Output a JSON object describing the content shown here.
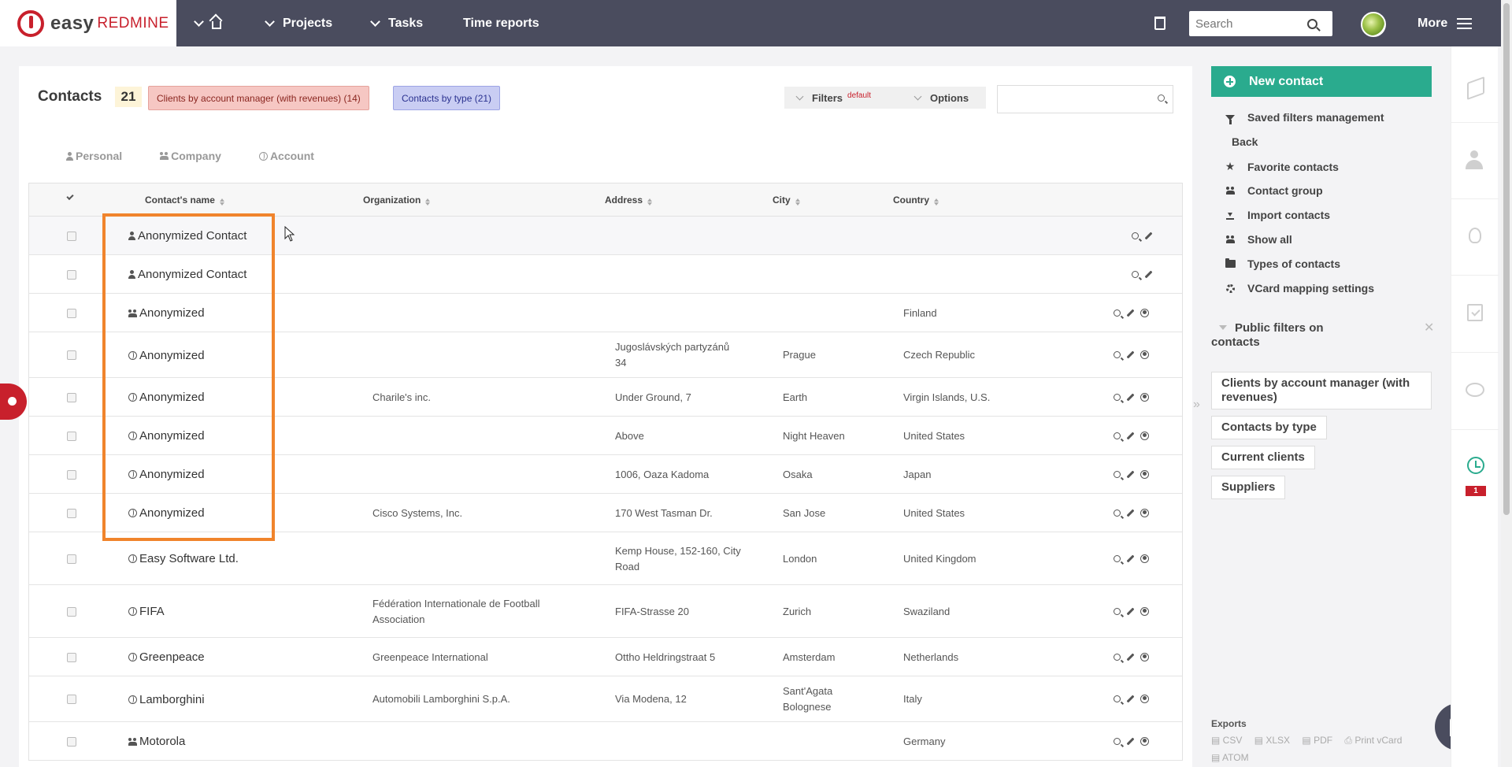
{
  "topbar": {
    "logo": {
      "part1": "easy",
      "part2": "REDMINE"
    },
    "nav": [
      {
        "label": ""
      },
      {
        "label": "Projects"
      },
      {
        "label": "Tasks"
      },
      {
        "label": "Time reports"
      }
    ],
    "search_placeholder": "Search",
    "more_label": "More"
  },
  "main": {
    "title": "Contacts",
    "count": "21",
    "tags": [
      {
        "label": "Clients by account manager (with revenues) (14)"
      },
      {
        "label": "Contacts by type (21)"
      }
    ],
    "filters_label": "Filters",
    "filters_default": "default",
    "options_label": "Options",
    "subtabs": [
      {
        "label": "Personal",
        "icon": "person-icon"
      },
      {
        "label": "Company",
        "icon": "group-icon"
      },
      {
        "label": "Account",
        "icon": "globe-icon"
      }
    ]
  },
  "table": {
    "headers": {
      "name": "Contact's name",
      "organization": "Organization",
      "address": "Address",
      "city": "City",
      "country": "Country"
    },
    "rows": [
      {
        "type": "person",
        "name": "Anonymized Contact",
        "org": "",
        "addr1": "",
        "addr2": "",
        "city1": "",
        "city2": "",
        "country": "",
        "actions": 2
      },
      {
        "type": "person",
        "name": "Anonymized Contact",
        "org": "",
        "addr1": "",
        "addr2": "",
        "city1": "",
        "city2": "",
        "country": "",
        "actions": 2
      },
      {
        "type": "group",
        "name": "Anonymized",
        "org": "",
        "addr1": "",
        "addr2": "",
        "city1": "",
        "city2": "",
        "country": "Finland",
        "actions": 3
      },
      {
        "type": "globe",
        "name": "Anonymized",
        "org": "",
        "addr1": "Jugoslávských partyzánů",
        "addr2": "34",
        "city1": "Prague",
        "city2": "",
        "country": "Czech Republic",
        "actions": 3
      },
      {
        "type": "globe",
        "name": "Anonymized",
        "org": "Charile's inc.",
        "addr1": "Under Ground, 7",
        "addr2": "",
        "city1": "Earth",
        "city2": "",
        "country": "Virgin Islands, U.S.",
        "actions": 3
      },
      {
        "type": "globe",
        "name": "Anonymized",
        "org": "",
        "addr1": "Above",
        "addr2": "",
        "city1": "Night Heaven",
        "city2": "",
        "country": "United States",
        "actions": 3
      },
      {
        "type": "globe",
        "name": "Anonymized",
        "org": "",
        "addr1": "1006, Oaza Kadoma",
        "addr2": "",
        "city1": "Osaka",
        "city2": "",
        "country": "Japan",
        "actions": 3
      },
      {
        "type": "globe",
        "name": "Anonymized",
        "org": "Cisco Systems, Inc.",
        "addr1": "170 West Tasman Dr.",
        "addr2": "",
        "city1": "San Jose",
        "city2": "",
        "country": "United States",
        "actions": 3
      },
      {
        "type": "globe",
        "name": "Easy Software Ltd.",
        "org": "",
        "addr1": "Kemp House, 152-160, City",
        "addr2": "Road",
        "city1": "London",
        "city2": "",
        "country": "United Kingdom",
        "actions": 3
      },
      {
        "type": "globe",
        "name": "FIFA",
        "org": "Fédération Internationale de Football",
        "org2": "Association",
        "addr1": "FIFA-Strasse 20",
        "addr2": "",
        "city1": "Zurich",
        "city2": "",
        "country": "Swaziland",
        "actions": 3
      },
      {
        "type": "globe",
        "name": "Greenpeace",
        "org": "Greenpeace International",
        "addr1": "Ottho Heldringstraat 5",
        "addr2": "",
        "city1": "Amsterdam",
        "city2": "",
        "country": "Netherlands",
        "actions": 3
      },
      {
        "type": "globe",
        "name": "Lamborghini",
        "org": "Automobili Lamborghini S.p.A.",
        "addr1": "Via Modena, 12",
        "addr2": "",
        "city1": "Sant'Agata",
        "city2": "Bolognese",
        "country": "Italy",
        "actions": 3
      },
      {
        "type": "group",
        "name": "Motorola",
        "org": "",
        "addr1": "",
        "addr2": "",
        "city1": "",
        "city2": "",
        "country": "Germany",
        "actions": 3
      }
    ]
  },
  "sidebar": {
    "new_contact": "New contact",
    "items": [
      {
        "label": "Saved filters management",
        "icon": "funnel-icon"
      },
      {
        "label": "Back",
        "icon": ""
      },
      {
        "label": "Favorite contacts",
        "icon": "star-icon"
      },
      {
        "label": "Contact group",
        "icon": "group-icon"
      },
      {
        "label": "Import contacts",
        "icon": "import-icon"
      },
      {
        "label": "Show all",
        "icon": "group-icon"
      },
      {
        "label": "Types of contacts",
        "icon": "folder-icon"
      },
      {
        "label": "VCard mapping settings",
        "icon": "gear-icon"
      }
    ],
    "public_filters_title_1": "Public filters on",
    "public_filters_title_2": "contacts",
    "public_filters": [
      {
        "label": "Clients by account manager (with revenues)"
      },
      {
        "label": "Contacts by type"
      },
      {
        "label": "Current clients"
      },
      {
        "label": "Suppliers"
      }
    ],
    "exports_title": "Exports",
    "exports": [
      "CSV",
      "XLSX",
      "PDF",
      "Print vCard",
      "ATOM"
    ]
  },
  "strip": {
    "badge": "1"
  },
  "colors": {
    "topbar": "#4a4c5e",
    "accent": "#2aab8e",
    "brand_red": "#c8202c",
    "highlight": "#f0842c"
  }
}
